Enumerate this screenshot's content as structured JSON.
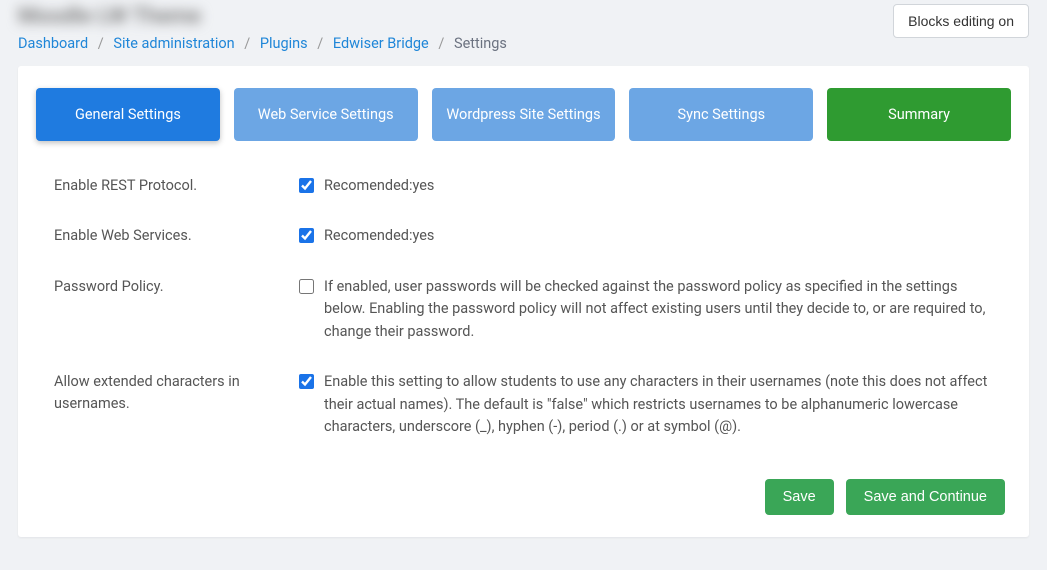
{
  "header": {
    "blurred_title": "Moodle LW Theme",
    "blocks_button": "Blocks editing on"
  },
  "breadcrumb": {
    "items": [
      "Dashboard",
      "Site administration",
      "Plugins",
      "Edwiser Bridge"
    ],
    "current": "Settings"
  },
  "tabs": {
    "general": "General Settings",
    "webservice": "Web Service Settings",
    "wordpress": "Wordpress Site Settings",
    "sync": "Sync Settings",
    "summary": "Summary"
  },
  "settings": {
    "rest": {
      "label": "Enable REST Protocol.",
      "checked": true,
      "desc": "Recomended:yes"
    },
    "webservices": {
      "label": "Enable Web Services.",
      "checked": true,
      "desc": "Recomended:yes"
    },
    "password": {
      "label": "Password Policy.",
      "checked": false,
      "desc": "If enabled, user passwords will be checked against the password policy as specified in the settings below. Enabling the password policy will not affect existing users until they decide to, or are required to, change their password."
    },
    "extchars": {
      "label": "Allow extended characters in usernames.",
      "checked": true,
      "desc": "Enable this setting to allow students to use any characters in their usernames (note this does not affect their actual names). The default is \"false\" which restricts usernames to be alphanumeric lowercase characters, underscore (_), hyphen (-), period (.) or at symbol (@)."
    }
  },
  "actions": {
    "save": "Save",
    "save_continue": "Save and Continue"
  }
}
